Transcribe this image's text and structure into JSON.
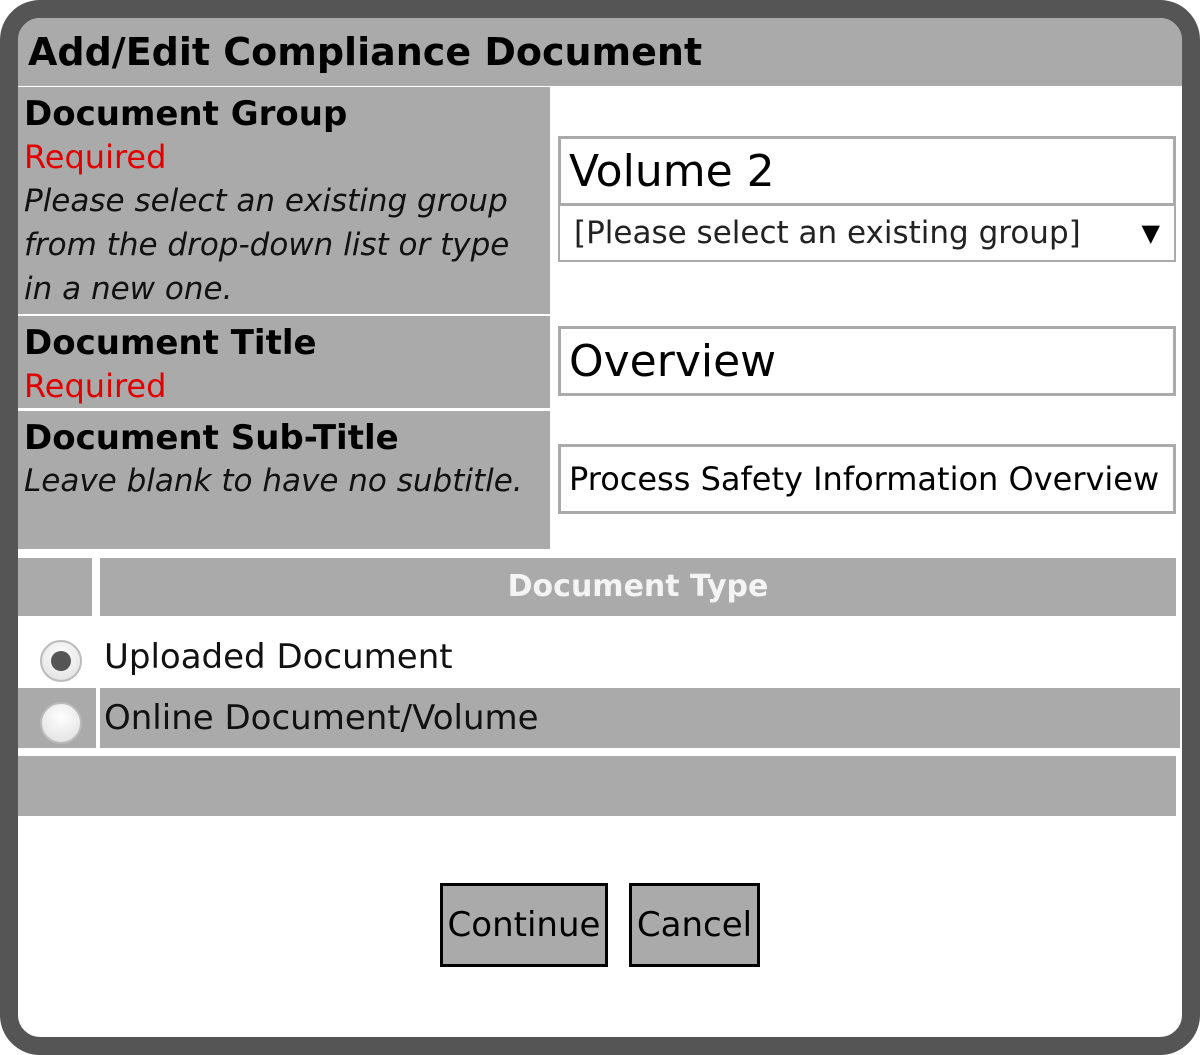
{
  "dialog": {
    "title": "Add/Edit Compliance Document"
  },
  "document_group": {
    "label": "Document Group",
    "required": "Required",
    "help": "Please select an existing group from the drop-down list or type in a new one.",
    "value": "Volume 2",
    "select_value": "[Please select an existing group]"
  },
  "document_title": {
    "label": "Document Title",
    "required": "Required",
    "value": "Overview"
  },
  "document_subtitle": {
    "label": "Document Sub-Title",
    "help": "Leave blank to have no subtitle.",
    "value": "Process Safety Information Overview"
  },
  "document_type": {
    "header": "Document Type",
    "selected": "Uploaded Document",
    "options": [
      {
        "label": "Uploaded Document",
        "checked": true
      },
      {
        "label": "Online Document/Volume",
        "checked": false
      }
    ]
  },
  "buttons": {
    "continue_label": "Continue",
    "cancel_label": "Cancel"
  },
  "colors": {
    "frame": "#555555",
    "panel_grey": "#aaaaaa",
    "required_red": "#e00000"
  }
}
